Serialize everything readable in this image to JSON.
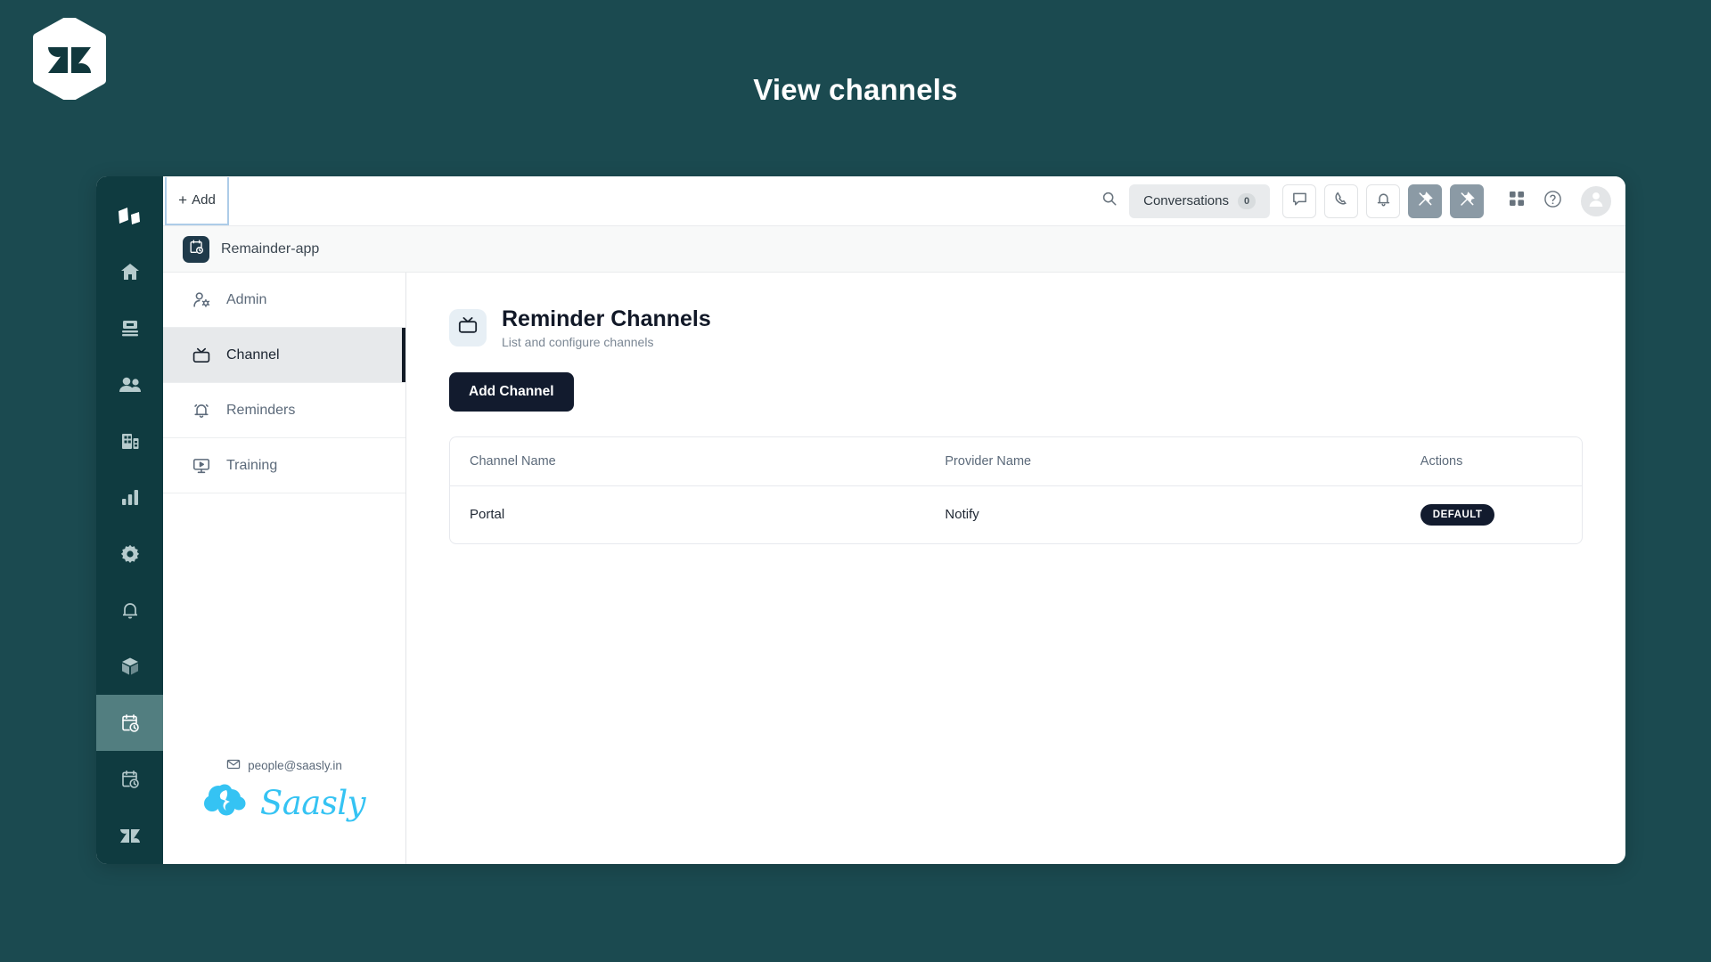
{
  "page": {
    "title": "View channels",
    "background_color": "#1b4a50",
    "logo_icon": "zendesk-logo-icon"
  },
  "toolbar": {
    "add_label": "Add",
    "add_plus": "+",
    "search_icon": "search-icon",
    "conversations_label": "Conversations",
    "conversations_count": "0",
    "buttons": [
      {
        "icon": "chat-icon",
        "style": "outline"
      },
      {
        "icon": "phone-icon",
        "style": "outline"
      },
      {
        "icon": "bell-icon",
        "style": "outline"
      },
      {
        "icon": "pin-off-icon",
        "style": "filled"
      },
      {
        "icon": "pin-off-icon",
        "style": "filled"
      }
    ],
    "apps_icon": "grid-apps-icon",
    "help_icon": "help-circle-icon",
    "avatar_icon": "user-avatar-icon"
  },
  "rail": {
    "items": [
      {
        "icon": "zendesk-logo-icon",
        "active": false
      },
      {
        "icon": "home-icon",
        "active": false
      },
      {
        "icon": "views-icon",
        "active": false
      },
      {
        "icon": "customers-icon",
        "active": false
      },
      {
        "icon": "organizations-icon",
        "active": false
      },
      {
        "icon": "reporting-icon",
        "active": false
      },
      {
        "icon": "settings-gear-icon",
        "active": false
      },
      {
        "icon": "bell-icon",
        "active": false
      },
      {
        "icon": "product-box-icon",
        "active": false
      },
      {
        "icon": "calendar-clock-icon",
        "active": true
      },
      {
        "icon": "calendar-clock-icon",
        "active": false
      },
      {
        "icon": "zendesk-z-icon",
        "active": false
      }
    ]
  },
  "appbar": {
    "icon": "calendar-clock-icon",
    "title": "Remainder-app"
  },
  "menu": {
    "items": [
      {
        "label": "Admin",
        "icon": "user-gear-icon",
        "active": false
      },
      {
        "label": "Channel",
        "icon": "tv-icon",
        "active": true
      },
      {
        "label": "Reminders",
        "icon": "bell-ringing-icon",
        "active": false
      },
      {
        "label": "Training",
        "icon": "monitor-play-icon",
        "active": false
      }
    ],
    "footer": {
      "mail_icon": "envelope-icon",
      "email": "people@saasly.in",
      "brand_icon": "saasly-cloud-icon",
      "brand_name": "Saasly",
      "brand_color": "#35c3f3"
    }
  },
  "content": {
    "icon": "tv-icon",
    "title": "Reminder Channels",
    "subtitle": "List and configure channels",
    "add_channel_label": "Add Channel",
    "table": {
      "columns": [
        "Channel Name",
        "Provider Name",
        "Actions"
      ],
      "rows": [
        {
          "channel_name": "Portal",
          "provider_name": "Notify",
          "action_badge": "DEFAULT"
        }
      ]
    }
  }
}
